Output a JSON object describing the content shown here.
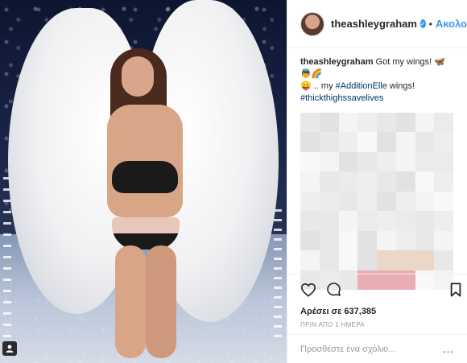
{
  "post": {
    "username": "theashleygraham",
    "follow_label": "Ακολουθήστε",
    "caption": {
      "username": "theashleygraham",
      "text1": "Got my wings! 🦋👼🌈",
      "text2": "😛 .. my ",
      "tag1": "#AdditionElle",
      "text3": " wings!",
      "tag2": "#thickthighssavelives"
    },
    "likes": "Αρέσει σε 637,385",
    "time": "ΠΡΙΝ ΑΠΟ 1 ΗΜΕΡΑ",
    "comment_placeholder": "Προσθέστε ένα σχόλιο...",
    "more_label": "..."
  },
  "colors": {
    "accent": "#3897f0",
    "hashtag": "#003569"
  },
  "icons": [
    "heart-icon",
    "comment-icon",
    "bookmark-icon",
    "verified-icon",
    "user-tag-icon"
  ]
}
